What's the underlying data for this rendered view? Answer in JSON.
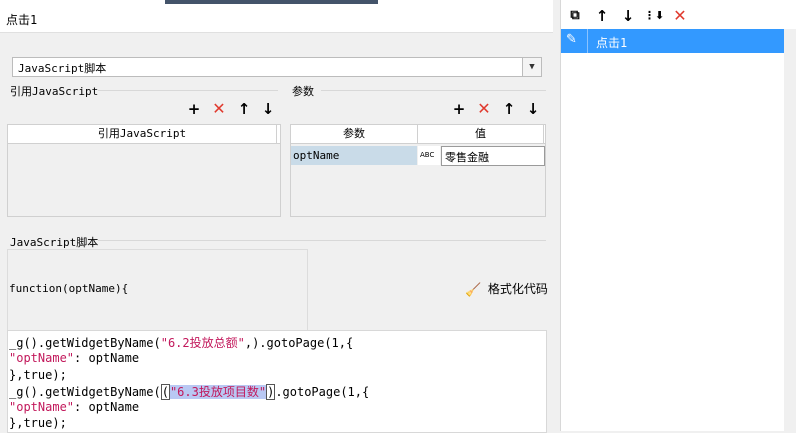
{
  "window": {
    "title": "点击1"
  },
  "script_type": {
    "selected": "JavaScript脚本"
  },
  "ref_js": {
    "label": "引用JavaScript",
    "col_header": "引用JavaScript"
  },
  "params": {
    "label": "参数",
    "col_param": "参数",
    "col_value": "值",
    "rows": [
      {
        "name": "optName",
        "type_icon": "ABC",
        "value": "零售金融"
      }
    ]
  },
  "js_script": {
    "label": "JavaScript脚本",
    "signature": "function(optName){",
    "format_button": "格式化代码"
  },
  "code": {
    "l1_a": "_g().getWidgetByName(",
    "l1_b": "\"6.2投放总额\"",
    "l1_c": ",).gotoPage(1,{",
    "l2_a": "\"optName\"",
    "l2_b": ": optName",
    "l3": "},true);",
    "l4_a": "_g().getWidgetByName(",
    "l4_b": "(",
    "l4_c": "\"6.3投放项目数\"",
    "l4_d": ")",
    "l4_e": ".gotoPage(1,{",
    "l5_a": "\"optName\"",
    "l5_b": ": optName",
    "l6": "},true);"
  },
  "events": {
    "items": [
      "点击1"
    ]
  },
  "colors": {
    "selection": "#3399ff",
    "delete_red": "#e03a2e",
    "string": "#c2185b"
  }
}
